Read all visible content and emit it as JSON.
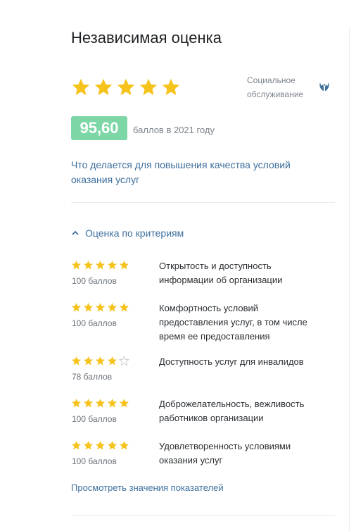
{
  "title": "Независимая оценка",
  "rating": {
    "stars": 5,
    "max": 5
  },
  "category": {
    "label": "Социальное обслуживание",
    "icon": "hands-icon"
  },
  "score": {
    "value": "95,60",
    "caption": "баллов в 2021 году",
    "badge_color": "#7dd6a6"
  },
  "improve_link": "Что делается для повышения качества условий оказания услуг",
  "criteria": {
    "toggle_label": "Оценка по критериям",
    "toggle_icon": "chevron-up-icon",
    "items": [
      {
        "stars": 5,
        "points": "100 баллов",
        "label": "Открытость и доступность информации об организации"
      },
      {
        "stars": 5,
        "points": "100 баллов",
        "label": "Комфортность условий предоставления услуг, в том числе время ее предоставления"
      },
      {
        "stars": 4,
        "points": "78 баллов",
        "label": "Доступность услуг для инвалидов"
      },
      {
        "stars": 5,
        "points": "100 баллов",
        "label": "Доброжелательность, вежливость работников организации"
      },
      {
        "stars": 5,
        "points": "100 баллов",
        "label": "Удовлетворенность условиями оказания услуг"
      }
    ]
  },
  "view_link": "Просмотреть значения показателей",
  "colors": {
    "star_filled": "#f6c31c",
    "star_empty_stroke": "#c8ccd0",
    "link": "#3d6f9d",
    "icon_blue": "#3d6f9d"
  }
}
